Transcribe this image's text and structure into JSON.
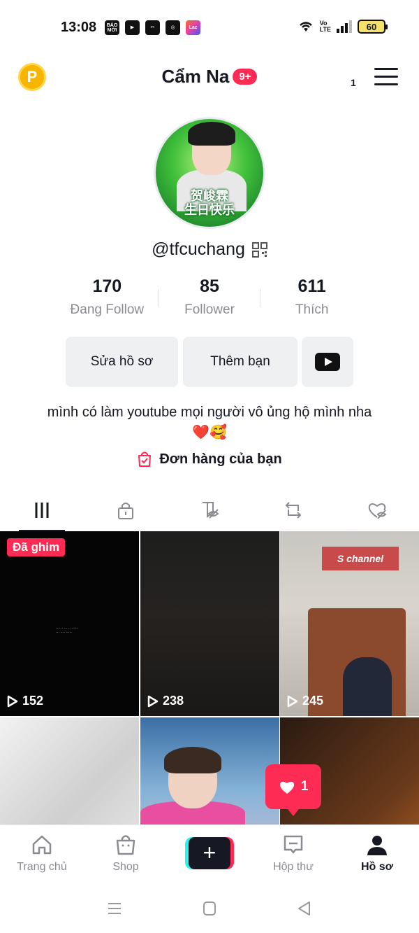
{
  "status_bar": {
    "time": "13:08",
    "apps": [
      "BÁO MỚI",
      "YouTube",
      "CapCut",
      "Chrome",
      "Lazada"
    ],
    "app_labels": {
      "baomoi": "BÁO MỚI"
    },
    "volte": "Vo LTE",
    "battery": "60"
  },
  "header": {
    "coin_letter": "P",
    "profile_name": "Cẩm Na",
    "notification_badge": "9+",
    "menu_count": "1"
  },
  "avatar": {
    "caption_line1": "贺峻霖",
    "caption_line2": "生日快乐"
  },
  "username": "@tfcuchang",
  "stats": [
    {
      "value": "170",
      "label": "Đang Follow"
    },
    {
      "value": "85",
      "label": "Follower"
    },
    {
      "value": "611",
      "label": "Thích"
    }
  ],
  "buttons": {
    "edit_profile": "Sửa hồ sơ",
    "add_friends": "Thêm bạn"
  },
  "bio": "mình có làm youtube mọi người vô ủng hộ mình nha❤️🥰",
  "orders_label": "Đơn hàng của bạn",
  "videos": [
    {
      "pinned_label": "Đã ghim",
      "views": "152"
    },
    {
      "views": "238"
    },
    {
      "views": "245",
      "sign_text": "S channel"
    },
    {},
    {},
    {}
  ],
  "like_popup_count": "1",
  "bottom_nav": {
    "home": "Trang chủ",
    "shop": "Shop",
    "inbox": "Hộp thư",
    "profile": "Hồ sơ"
  },
  "colors": {
    "accent": "#fe2c55",
    "cyan": "#25f4ee",
    "text": "#161823",
    "muted": "#8a8b91"
  }
}
